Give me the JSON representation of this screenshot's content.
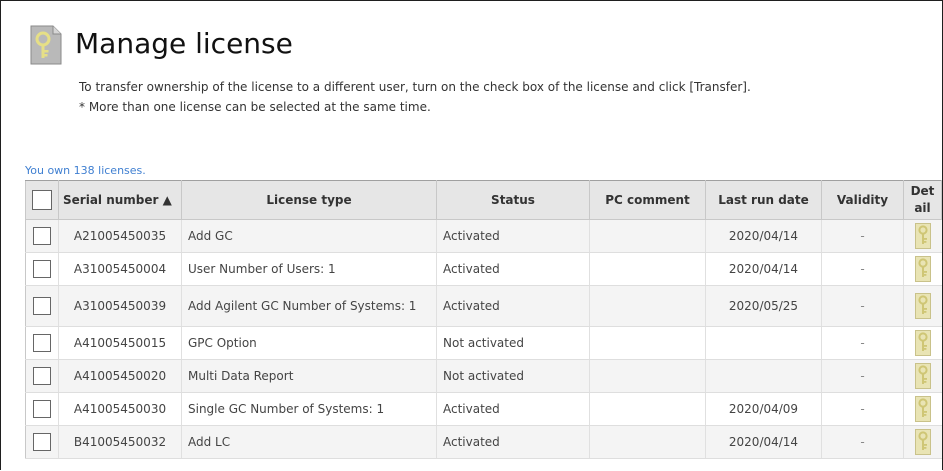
{
  "page": {
    "title": "Manage license",
    "description_line1": "To transfer ownership of the license to a different user, turn on the check box of the license and click [Transfer].",
    "description_line2": "* More than one license can be selected at the same time.",
    "owned_text": "You own 138 licenses.",
    "header_icon": "key-icon"
  },
  "table": {
    "columns": {
      "serial": "Serial number ▲",
      "license_type": "License type",
      "status": "Status",
      "pc_comment": "PC comment",
      "last_run": "Last run date",
      "validity": "Validity",
      "detail_l1": "Det",
      "detail_l2": "ail"
    },
    "rows": [
      {
        "serial": "A21005450035",
        "license_type": "Add GC",
        "status": "Activated",
        "pc_comment": "",
        "last_run": "2020/04/14",
        "validity": "-"
      },
      {
        "serial": "A31005450004",
        "license_type": "User Number of Users: 1",
        "status": "Activated",
        "pc_comment": "",
        "last_run": "2020/04/14",
        "validity": "-"
      },
      {
        "serial": "A31005450039",
        "license_type": "Add Agilent GC Number of Systems: 1",
        "status": "Activated",
        "pc_comment": "",
        "last_run": "2020/05/25",
        "validity": "-"
      },
      {
        "serial": "A41005450015",
        "license_type": "GPC Option",
        "status": "Not activated",
        "pc_comment": "",
        "last_run": "",
        "validity": "-"
      },
      {
        "serial": "A41005450020",
        "license_type": "Multi Data Report",
        "status": "Not activated",
        "pc_comment": "",
        "last_run": "",
        "validity": "-"
      },
      {
        "serial": "A41005450030",
        "license_type": "Single GC Number of Systems: 1",
        "status": "Activated",
        "pc_comment": "",
        "last_run": "2020/04/09",
        "validity": "-"
      },
      {
        "serial": "B41005450032",
        "license_type": "Add LC",
        "status": "Activated",
        "pc_comment": "",
        "last_run": "2020/04/14",
        "validity": "-"
      }
    ],
    "detail_icon": "key-icon"
  },
  "colors": {
    "accent_link": "#3f7fd1",
    "header_bg": "#e6e6e6",
    "key_icon": "#d8d29a"
  }
}
